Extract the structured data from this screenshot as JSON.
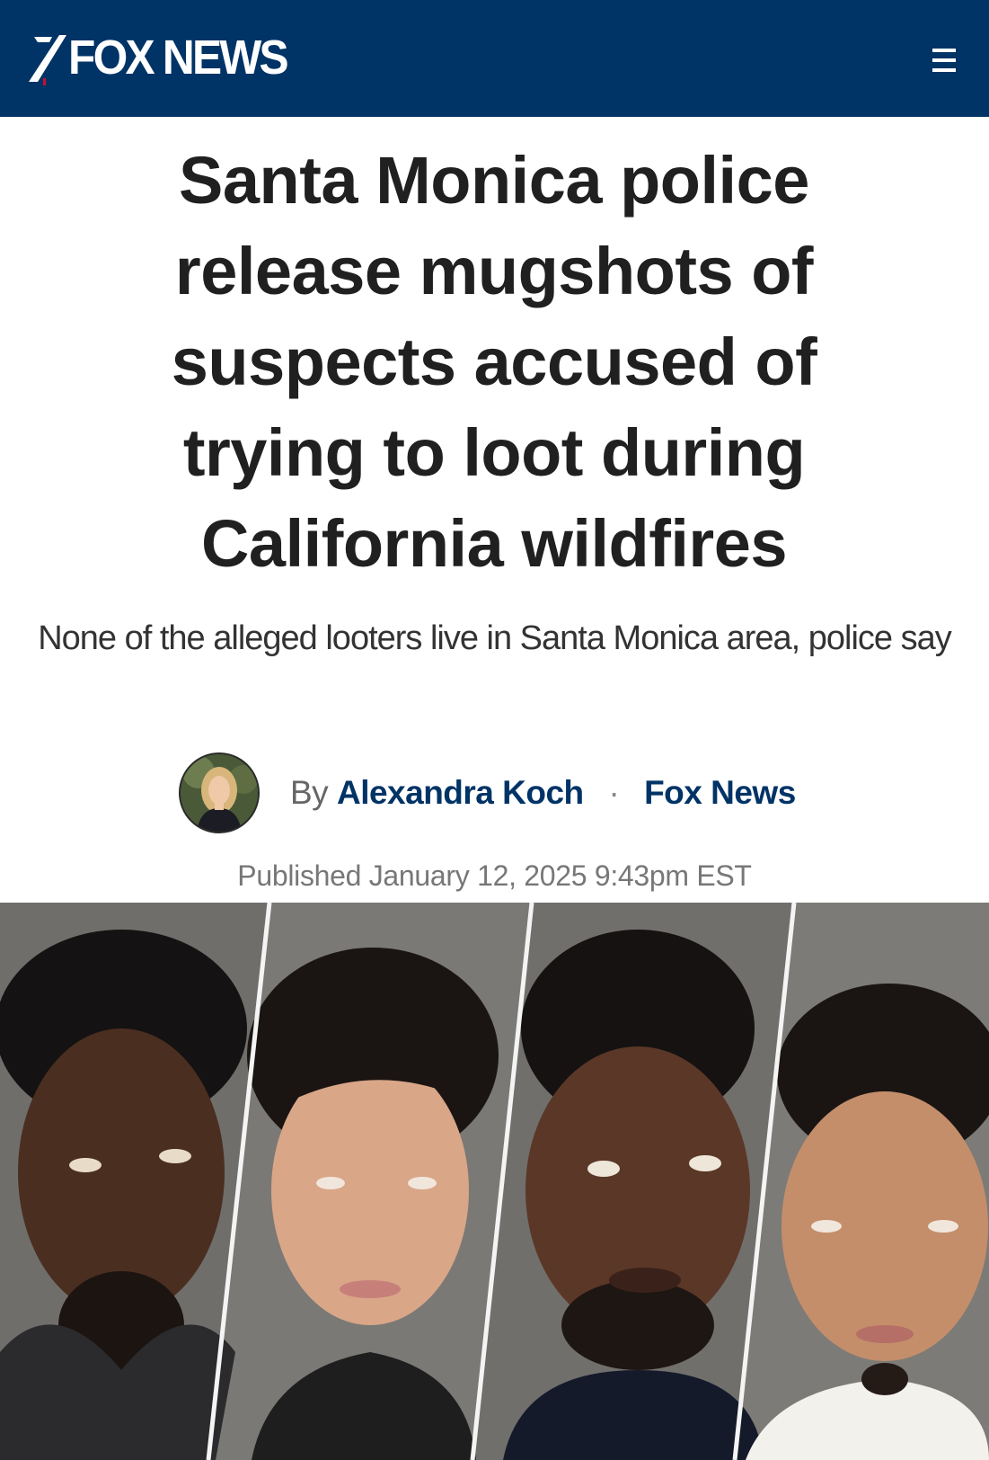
{
  "header": {
    "logo_text": "FOX NEWS",
    "menu_icon": "hamburger-menu-icon",
    "background_color": "#003366"
  },
  "article": {
    "headline": "Santa Monica police release mugshots of suspects accused of trying to loot during California wildfires",
    "dek": "None of the alleged looters live in Santa Monica area, police say",
    "byline": {
      "prefix": "By",
      "author": "Alexandra Koch",
      "separator": "·",
      "source": "Fox News"
    },
    "published": "Published January 12, 2025 9:43pm EST"
  },
  "colors": {
    "link": "#003366",
    "headline": "#202020"
  }
}
